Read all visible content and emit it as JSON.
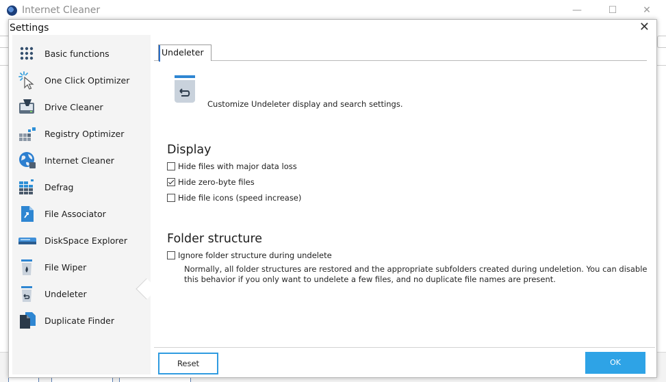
{
  "app": {
    "title": "Internet Cleaner",
    "window_controls": {
      "minimize": "—",
      "maximize": "☐",
      "close": "✕"
    }
  },
  "dialog": {
    "title": "Settings",
    "close_glyph": "✕"
  },
  "sidebar": {
    "items": [
      {
        "label": "Basic functions",
        "icon": "dots-grid-icon"
      },
      {
        "label": "One Click Optimizer",
        "icon": "cursor-click-icon"
      },
      {
        "label": "Drive Cleaner",
        "icon": "drive-cleaner-icon"
      },
      {
        "label": "Registry Optimizer",
        "icon": "registry-icon"
      },
      {
        "label": "Internet Cleaner",
        "icon": "globe-icon"
      },
      {
        "label": "Defrag",
        "icon": "defrag-icon"
      },
      {
        "label": "File Associator",
        "icon": "file-associator-icon"
      },
      {
        "label": "DiskSpace Explorer",
        "icon": "disk-drive-icon"
      },
      {
        "label": "File Wiper",
        "icon": "file-wiper-icon"
      },
      {
        "label": "Undeleter",
        "icon": "undeleter-icon",
        "selected": true
      },
      {
        "label": "Duplicate Finder",
        "icon": "duplicate-files-icon"
      }
    ]
  },
  "tab": {
    "label": "Undeleter"
  },
  "header": {
    "description": "Customize Undeleter display and search settings."
  },
  "display": {
    "title": "Display",
    "options": [
      {
        "label": "Hide files with major data loss",
        "checked": false
      },
      {
        "label": "Hide zero-byte files",
        "checked": true
      },
      {
        "label": "Hide file icons (speed increase)",
        "checked": false
      }
    ]
  },
  "folder": {
    "title": "Folder structure",
    "option": {
      "label": "Ignore folder structure during undelete",
      "checked": false
    },
    "note": "Normally, all folder structures are restored and the appropriate subfolders created during undeletion. You can disable this behavior if you only want to undelete a few files, and no duplicate file names are present."
  },
  "buttons": {
    "reset": "Reset",
    "ok": "OK"
  },
  "colors": {
    "accent": "#2ea3e6",
    "selected_border": "#2f9be0",
    "sidebar_bg": "#f4f4f4"
  }
}
